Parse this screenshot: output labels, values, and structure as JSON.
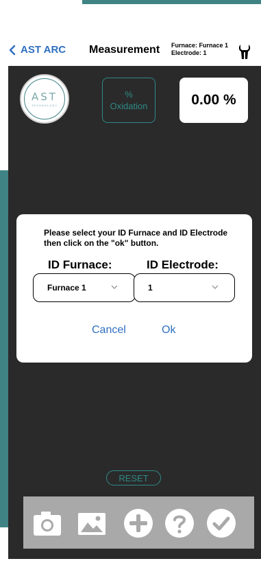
{
  "nav": {
    "back_label": "AST ARC",
    "title": "Measurement",
    "furnace_line": "Furnace: Furnace 1",
    "electrode_line": "Electrode: 1"
  },
  "logo": {
    "text": "AST",
    "subtitle": "TECHNOLOGY"
  },
  "oxidation": {
    "symbol": "%",
    "label": "Oxidation",
    "value": "0.00 %"
  },
  "dialog": {
    "message": "Please select your ID Furnace and ID Electrode then click on the \"ok\" button.",
    "furnace_label": "ID Furnace:",
    "electrode_label": "ID Electrode:",
    "furnace_value": "Furnace 1",
    "electrode_value": "1",
    "cancel_label": "Cancel",
    "ok_label": "Ok"
  },
  "reset_label": "RESET",
  "toolbar": {
    "icons": [
      "camera-icon",
      "image-icon",
      "add-icon",
      "help-icon",
      "check-icon"
    ]
  },
  "colors": {
    "teal": "#2f8a86",
    "link_blue": "#2f6fc0",
    "panel_dark": "#2a2a2a",
    "toolbar_gray": "#a9a9a9"
  }
}
